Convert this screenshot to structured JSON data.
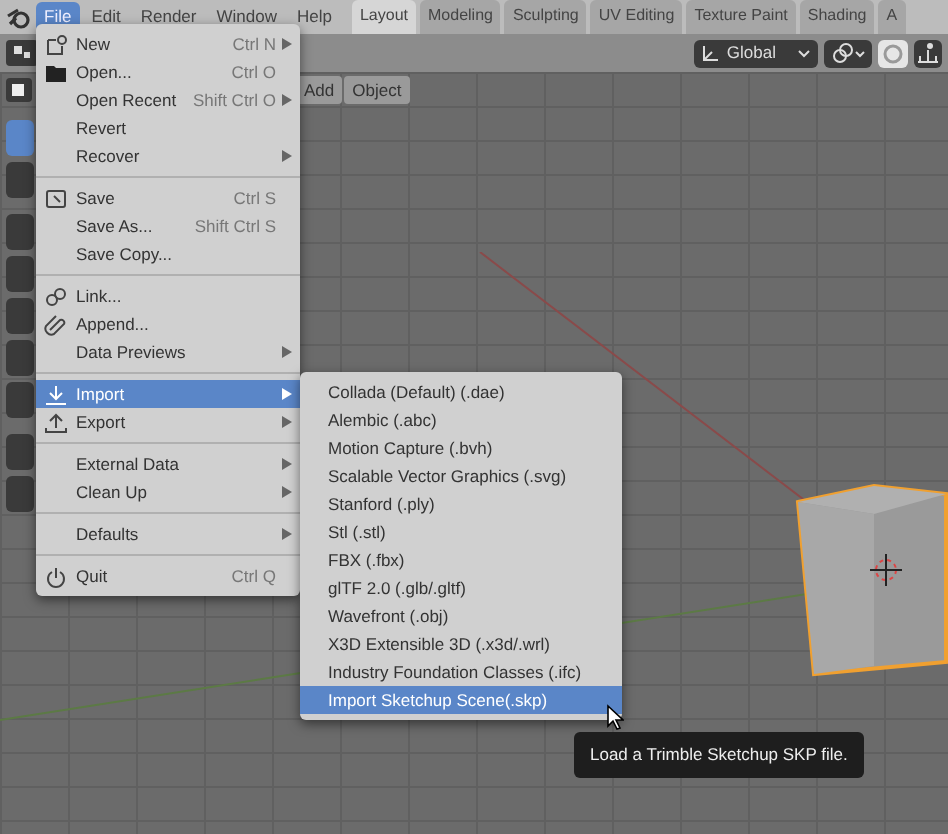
{
  "menubar": [
    {
      "label": "File",
      "selected": true
    },
    {
      "label": "Edit",
      "selected": false
    },
    {
      "label": "Render",
      "selected": false
    },
    {
      "label": "Window",
      "selected": false
    },
    {
      "label": "Help",
      "selected": false
    }
  ],
  "workspace_tabs": [
    {
      "label": "Layout",
      "selected": true
    },
    {
      "label": "Modeling",
      "selected": false
    },
    {
      "label": "Sculpting",
      "selected": false
    },
    {
      "label": "UV Editing",
      "selected": false
    },
    {
      "label": "Texture Paint",
      "selected": false
    },
    {
      "label": "Shading",
      "selected": false
    },
    {
      "label": "A",
      "selected": false
    }
  ],
  "header": {
    "orientation": "Global"
  },
  "viewport_menus": [
    "Add",
    "Object"
  ],
  "file_menu": [
    [
      {
        "label": "New",
        "shortcut": "Ctrl N",
        "submenu": true,
        "selected": false
      },
      {
        "label": "Open...",
        "shortcut": "Ctrl O",
        "submenu": false,
        "selected": false
      },
      {
        "label": "Open Recent",
        "shortcut": "Shift Ctrl O",
        "submenu": true,
        "selected": false
      },
      {
        "label": "Revert",
        "submenu": false,
        "selected": false
      },
      {
        "label": "Recover",
        "submenu": true,
        "selected": false
      }
    ],
    [
      {
        "label": "Save",
        "shortcut": "Ctrl S",
        "submenu": false,
        "selected": false
      },
      {
        "label": "Save As...",
        "shortcut": "Shift Ctrl S",
        "submenu": false,
        "selected": false
      },
      {
        "label": "Save Copy...",
        "submenu": false,
        "selected": false
      }
    ],
    [
      {
        "label": "Link...",
        "submenu": false,
        "selected": false
      },
      {
        "label": "Append...",
        "submenu": false,
        "selected": false
      },
      {
        "label": "Data Previews",
        "submenu": true,
        "selected": false
      }
    ],
    [
      {
        "label": "Import",
        "submenu": true,
        "selected": true
      },
      {
        "label": "Export",
        "submenu": true,
        "selected": false
      }
    ],
    [
      {
        "label": "External Data",
        "submenu": true,
        "selected": false
      },
      {
        "label": "Clean Up",
        "submenu": true,
        "selected": false
      }
    ],
    [
      {
        "label": "Defaults",
        "submenu": true,
        "selected": false
      }
    ],
    [
      {
        "label": "Quit",
        "shortcut": "Ctrl Q",
        "submenu": false,
        "selected": false
      }
    ]
  ],
  "import_menu": [
    {
      "label": "Collada (Default) (.dae)",
      "selected": false
    },
    {
      "label": "Alembic (.abc)",
      "selected": false
    },
    {
      "label": "Motion Capture (.bvh)",
      "selected": false
    },
    {
      "label": "Scalable Vector Graphics (.svg)",
      "selected": false
    },
    {
      "label": "Stanford (.ply)",
      "selected": false
    },
    {
      "label": "Stl (.stl)",
      "selected": false
    },
    {
      "label": "FBX (.fbx)",
      "selected": false
    },
    {
      "label": "glTF 2.0 (.glb/.gltf)",
      "selected": false
    },
    {
      "label": "Wavefront (.obj)",
      "selected": false
    },
    {
      "label": "X3D Extensible 3D (.x3d/.wrl)",
      "selected": false
    },
    {
      "label": "Industry Foundation Classes (.ifc)",
      "selected": false
    },
    {
      "label": "Import Sketchup Scene(.skp)",
      "selected": true
    }
  ],
  "tooltip": "Load a Trimble Sketchup SKP file."
}
